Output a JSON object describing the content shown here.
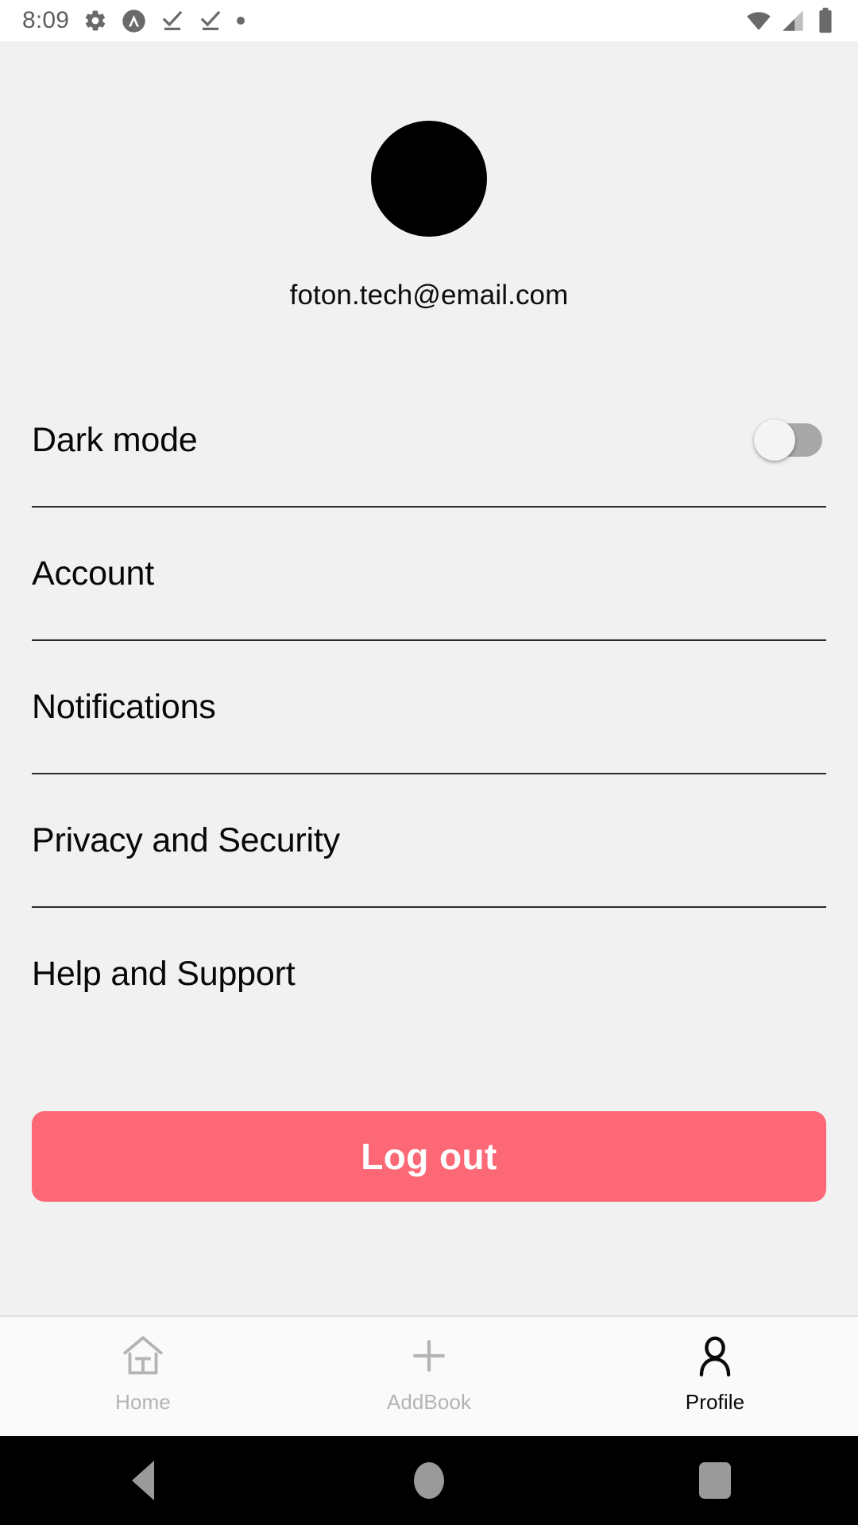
{
  "status_bar": {
    "time": "8:09",
    "left_icons": [
      "gear-icon",
      "app-logo-icon",
      "task-complete-icon",
      "task-complete-icon",
      "dot-icon"
    ],
    "right_icons": [
      "wifi-icon",
      "cellular-signal-icon",
      "battery-icon"
    ]
  },
  "profile": {
    "avatar": "avatar-image",
    "email": "foton.tech@email.com"
  },
  "settings": {
    "dark_mode": {
      "label": "Dark mode",
      "toggle_state": "off"
    },
    "items": [
      {
        "label": "Account"
      },
      {
        "label": "Notifications"
      },
      {
        "label": "Privacy and Security"
      },
      {
        "label": "Help and Support"
      }
    ]
  },
  "logout": {
    "label": "Log out",
    "color": "#FC6875",
    "text_color": "#FFFFFF"
  },
  "bottom_nav": {
    "items": [
      {
        "label": "Home",
        "icon": "home-icon",
        "active": false
      },
      {
        "label": "AddBook",
        "icon": "plus-icon",
        "active": false
      },
      {
        "label": "Profile",
        "icon": "person-icon",
        "active": true
      }
    ],
    "active_color": "#090909",
    "inactive_color": "#B4B4B4"
  },
  "system_nav": {
    "buttons": [
      "back-button",
      "home-button",
      "recents-button"
    ],
    "background": "#000000",
    "icon_color": "#9A9A9A"
  }
}
